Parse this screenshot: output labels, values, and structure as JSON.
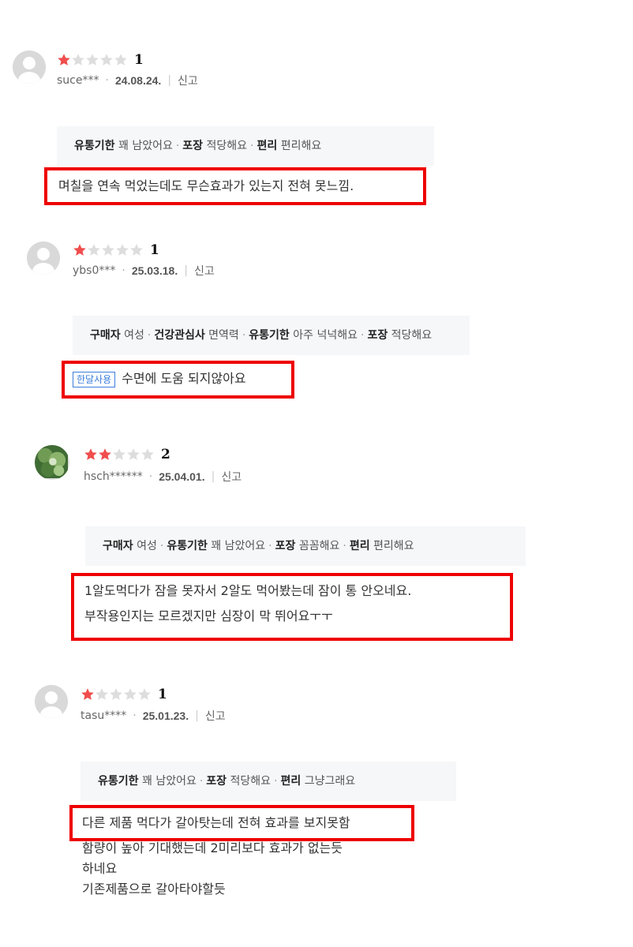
{
  "colors": {
    "star_filled": "#f04d4d",
    "star_empty": "#dddddd",
    "highlight_box": "#ee0000",
    "badge": "#3b7ddd"
  },
  "reviews": [
    {
      "rating": 1,
      "rating_label": "1",
      "user": "suce***",
      "date": "24.08.24.",
      "report": "신고",
      "tags": [
        {
          "k": "유통기한",
          "v": "꽤 남았어요"
        },
        {
          "k": "포장",
          "v": "적당해요"
        },
        {
          "k": "편리",
          "v": "편리해요"
        }
      ],
      "text": "며칠을 연속 먹었는데도 무슨효과가 있는지 전혀 못느낌."
    },
    {
      "rating": 1,
      "rating_label": "1",
      "user": "ybs0***",
      "date": "25.03.18.",
      "report": "신고",
      "tags": [
        {
          "k": "구매자",
          "v": "여성"
        },
        {
          "k": "건강관심사",
          "v": "면역력"
        },
        {
          "k": "유통기한",
          "v": "아주 넉넉해요"
        },
        {
          "k": "포장",
          "v": "적당해요"
        }
      ],
      "badge": "한달사용",
      "text": "수면에 도움 되지않아요"
    },
    {
      "rating": 2,
      "rating_label": "2",
      "user": "hsch******",
      "date": "25.04.01.",
      "report": "신고",
      "tags": [
        {
          "k": "구매자",
          "v": "여성"
        },
        {
          "k": "유통기한",
          "v": "꽤 남았어요"
        },
        {
          "k": "포장",
          "v": "꼼꼼해요"
        },
        {
          "k": "편리",
          "v": "편리해요"
        }
      ],
      "text_lines": [
        "1알도먹다가 잠을 못자서 2알도 먹어봤는데 잠이 통 안오네요.",
        "부작용인지는 모르겠지만 심장이 막 뛰어요ㅜㅜ"
      ]
    },
    {
      "rating": 1,
      "rating_label": "1",
      "user": "tasu****",
      "date": "25.01.23.",
      "report": "신고",
      "tags": [
        {
          "k": "유통기한",
          "v": "꽤 남았어요"
        },
        {
          "k": "포장",
          "v": "적당해요"
        },
        {
          "k": "편리",
          "v": "그냥그래요"
        }
      ],
      "text": "다른 제품 먹다가 갈아탓는데 전혀 효과를 보지못함",
      "extra_lines": [
        "함량이 높아 기대했는데 2미리보다 효과가  없는듯",
        "하네요",
        "기존제품으로 갈아타야할듯"
      ]
    }
  ]
}
